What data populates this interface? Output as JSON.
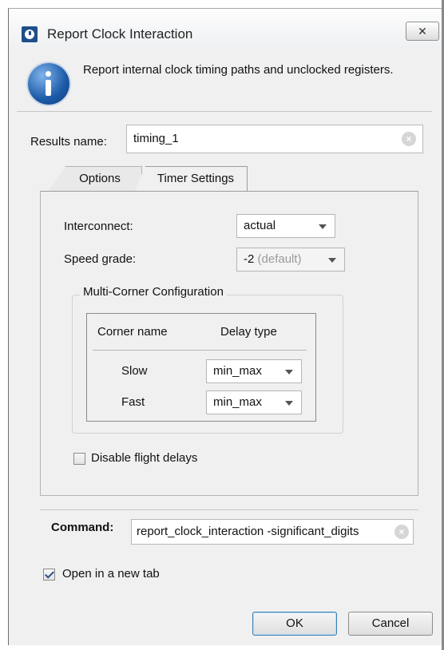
{
  "window": {
    "title": "Report Clock Interaction",
    "close_glyph": "✕"
  },
  "description": "Report internal clock timing paths and unclocked registers.",
  "results": {
    "label": "Results name:",
    "value": "timing_1"
  },
  "tabs": [
    {
      "label": "Options",
      "active": false
    },
    {
      "label": "Timer Settings",
      "active": true
    }
  ],
  "timer_settings": {
    "interconnect_label": "Interconnect:",
    "interconnect_value": "actual",
    "speed_grade_label": "Speed grade:",
    "speed_grade_value": "-2",
    "speed_grade_suffix": "(default)",
    "group_title": "Multi-Corner Configuration",
    "table_headers": [
      "Corner name",
      "Delay type"
    ],
    "corners": [
      {
        "name": "Slow",
        "delay_type": "min_max"
      },
      {
        "name": "Fast",
        "delay_type": "min_max"
      }
    ],
    "disable_flight_delays_label": "Disable flight delays",
    "disable_flight_delays_checked": false
  },
  "command": {
    "label": "Command:",
    "value": "report_clock_interaction -significant_digits"
  },
  "open_new_tab": {
    "label": "Open in a new tab",
    "checked": true
  },
  "buttons": {
    "ok": "OK",
    "cancel": "Cancel"
  },
  "colors": {
    "dialog_bg": "#f0f0f0",
    "accent": "#1c5aa8"
  },
  "icons": {
    "app": "report-app-icon",
    "info": "info-icon",
    "clear": "clear-icon",
    "dropdown": "chevron-down-icon"
  }
}
